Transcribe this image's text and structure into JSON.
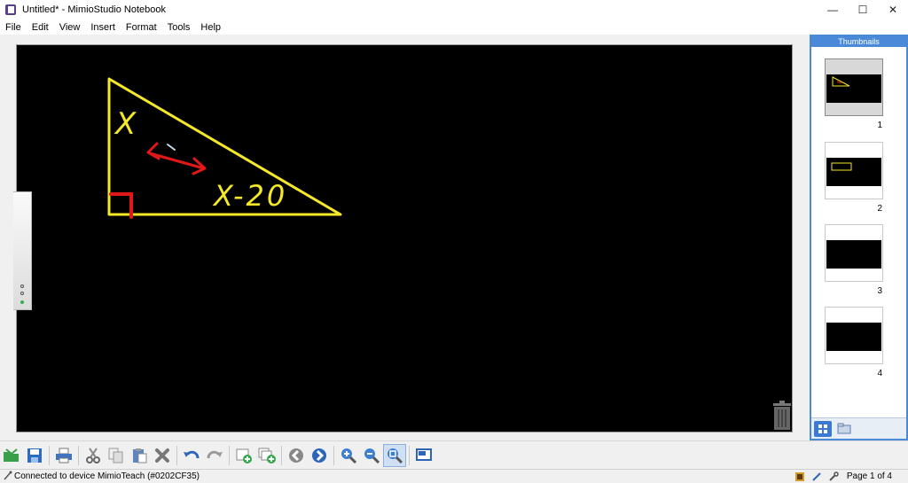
{
  "window": {
    "title": "Untitled* - MimioStudio Notebook",
    "minimize": "—",
    "maximize": "☐",
    "close": "✕"
  },
  "menu": [
    "File",
    "Edit",
    "View",
    "Insert",
    "Format",
    "Tools",
    "Help"
  ],
  "canvas": {
    "background": "#000000",
    "ink_yellow": "#f5e829",
    "ink_red": "#e01818",
    "label_x": "X",
    "label_expr": "X-20"
  },
  "thumbnails": {
    "header": "Thumbnails",
    "pages": [
      {
        "number": "1",
        "selected": true
      },
      {
        "number": "2",
        "selected": false
      },
      {
        "number": "3",
        "selected": false
      },
      {
        "number": "4",
        "selected": false
      }
    ]
  },
  "toolbar": {
    "buttons": [
      "open-icon",
      "save-icon",
      "print-icon",
      "cut-icon",
      "copy-icon",
      "paste-icon",
      "delete-icon",
      "undo-icon",
      "redo-icon",
      "new-page-icon",
      "duplicate-page-icon",
      "previous-page-icon",
      "next-page-icon",
      "zoom-in-icon",
      "zoom-out-icon",
      "zoom-fit-icon",
      "screen-icon"
    ]
  },
  "status": {
    "text": "Connected to device MimioTeach (#0202CF35)",
    "page": "Page 1 of 4"
  }
}
